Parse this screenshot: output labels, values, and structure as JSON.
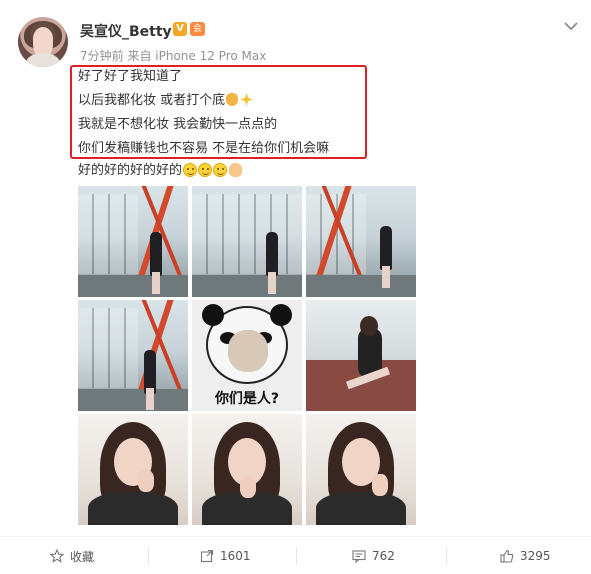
{
  "post": {
    "author": {
      "name": "吴宣仪_Betty",
      "badge_v": "V",
      "badge_vip": "会"
    },
    "meta": "7分钟前 来自 iPhone 12 Pro Max",
    "lines": [
      "好了好了我知道了",
      "以后我都化妆 或者打个底",
      "我就是不想化妆 我会勤快一点点的",
      "你们发稿赚钱也不容易 不是在给你们机会嘛",
      "好的好的好的好的"
    ],
    "meme_caption": "你们是人?"
  },
  "actions": {
    "favorite": "收藏",
    "repost": "1601",
    "comment": "762",
    "like": "3295"
  },
  "icons": {
    "menu": "chevron-down-icon",
    "favorite": "star-icon",
    "repost": "repost-icon",
    "comment": "comment-icon",
    "like": "thumbs-up-icon"
  },
  "colors": {
    "highlight_border": "#e02020",
    "meta_text": "#939393",
    "badge_v": "#f5a623"
  }
}
